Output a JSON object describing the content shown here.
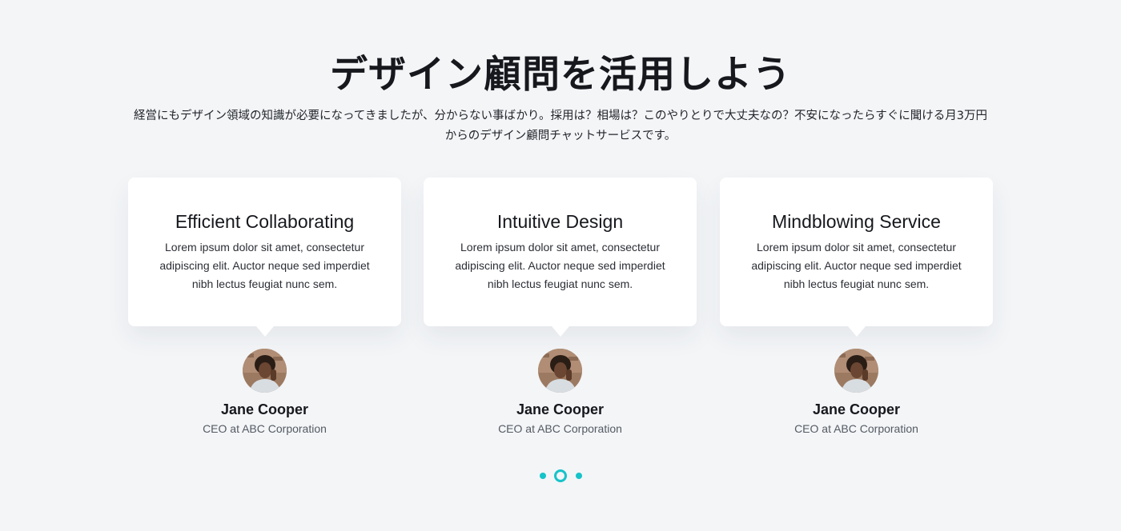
{
  "hero": {
    "title": "デザイン顧問を活用しよう",
    "subtitle": "経営にもデザイン領域の知識が必要になってきましたが、分からない事ばかり。採用は？相場は？このやりとりで大丈夫なの？不安になったらすぐに聞ける月3万円からのデザイン顧問チャットサービスです。"
  },
  "testimonials": [
    {
      "title": "Efficient Collaborating",
      "text": "Lorem ipsum dolor sit amet, consectetur adipiscing elit. Auctor neque sed imperdiet nibh lectus feugiat nunc sem.",
      "name": "Jane Cooper",
      "role": "CEO at ABC Corporation",
      "avatar_icon": "avatar-photo"
    },
    {
      "title": "Intuitive Design",
      "text": "Lorem ipsum dolor sit amet, consectetur adipiscing elit. Auctor neque sed imperdiet nibh lectus feugiat nunc sem.",
      "name": "Jane Cooper",
      "role": "CEO at ABC Corporation",
      "avatar_icon": "avatar-photo"
    },
    {
      "title": "Mindblowing Service",
      "text": "Lorem ipsum dolor sit amet, consectetur adipiscing elit. Auctor neque sed imperdiet nibh lectus feugiat nunc sem.",
      "name": "Jane Cooper",
      "role": "CEO at ABC Corporation",
      "avatar_icon": "avatar-photo"
    }
  ],
  "pagination": {
    "count": 3,
    "active_index": 1
  },
  "colors": {
    "accent": "#16c3c9",
    "background": "#f3f5f7",
    "card": "#ffffff"
  }
}
